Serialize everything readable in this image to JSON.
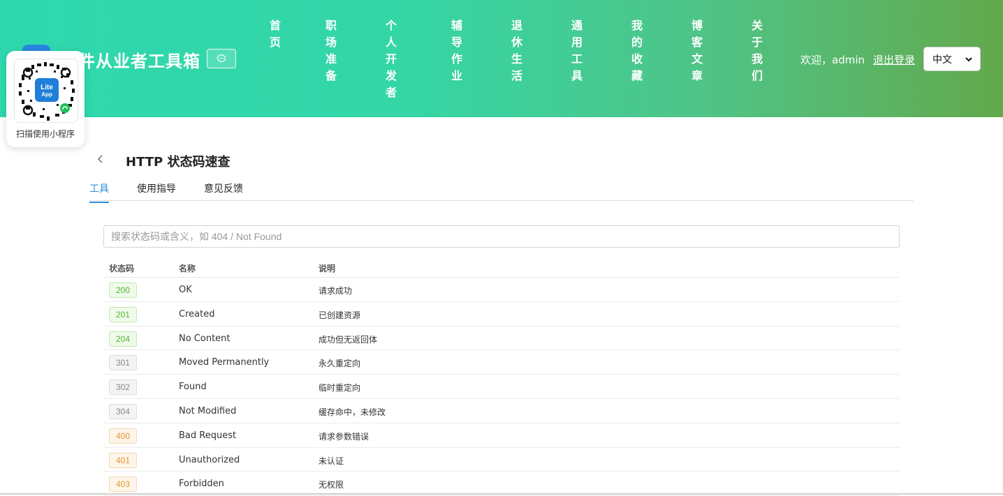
{
  "header": {
    "title": "件从业者工具箱",
    "nav": [
      {
        "label": "首页"
      },
      {
        "label": "职场准备"
      },
      {
        "label": "个人开发者"
      },
      {
        "label": "辅导作业"
      },
      {
        "label": "退休生活"
      },
      {
        "label": "通用工具"
      },
      {
        "label": "我的收藏"
      },
      {
        "label": "博客文章"
      },
      {
        "label": "关于我们"
      }
    ],
    "welcome": "欢迎，admin",
    "logout": "退出登录",
    "language": "中文"
  },
  "qr": {
    "caption": "扫描使用小程序",
    "logo_line1": "Lite",
    "logo_line2": "App"
  },
  "page": {
    "title": "HTTP 状态码速查",
    "tabs": [
      {
        "label": "工具",
        "active": true
      },
      {
        "label": "使用指导",
        "active": false
      },
      {
        "label": "意见反馈",
        "active": false
      }
    ],
    "search_placeholder": "搜索状态码或含义，如 404 / Not Found"
  },
  "table": {
    "headers": {
      "code": "状态码",
      "name": "名称",
      "desc": "说明"
    },
    "rows": [
      {
        "code": "200",
        "name": "OK",
        "desc": "请求成功",
        "kind": "success"
      },
      {
        "code": "201",
        "name": "Created",
        "desc": "已创建资源",
        "kind": "success"
      },
      {
        "code": "204",
        "name": "No Content",
        "desc": "成功但无返回体",
        "kind": "success"
      },
      {
        "code": "301",
        "name": "Moved Permanently",
        "desc": "永久重定向",
        "kind": "redirect"
      },
      {
        "code": "302",
        "name": "Found",
        "desc": "临时重定向",
        "kind": "redirect"
      },
      {
        "code": "304",
        "name": "Not Modified",
        "desc": "缓存命中，未修改",
        "kind": "redirect"
      },
      {
        "code": "400",
        "name": "Bad Request",
        "desc": "请求参数错误",
        "kind": "client-error"
      },
      {
        "code": "401",
        "name": "Unauthorized",
        "desc": "未认证",
        "kind": "client-error"
      },
      {
        "code": "403",
        "name": "Forbidden",
        "desc": "无权限",
        "kind": "client-error"
      }
    ]
  },
  "colors": {
    "accent": "#2f8fe0",
    "success_text": "#52b830",
    "success_bg": "#effaeb",
    "success_border": "#bfe8ad",
    "redirect_text": "#888888",
    "redirect_bg": "#f4f4f5",
    "redirect_border": "#dcdcdc",
    "client_text": "#e8972b",
    "client_bg": "#fdf5ea",
    "client_border": "#f6d8ac"
  }
}
